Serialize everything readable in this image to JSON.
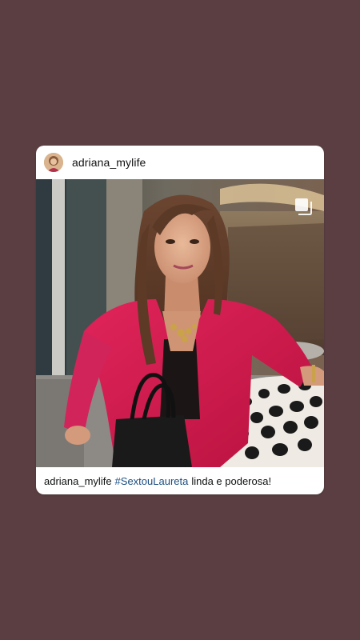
{
  "post": {
    "username": "adriana_mylife",
    "caption": {
      "username": "adriana_mylife",
      "hashtag": "#SextouLaureta",
      "text": "linda e poderosa!"
    },
    "photo_icon": "multiple-photos-icon",
    "avatar_icon": "profile-avatar"
  },
  "colors": {
    "background": "#5a3e41",
    "card": "#ffffff",
    "hashtag": "#1c4e80"
  }
}
